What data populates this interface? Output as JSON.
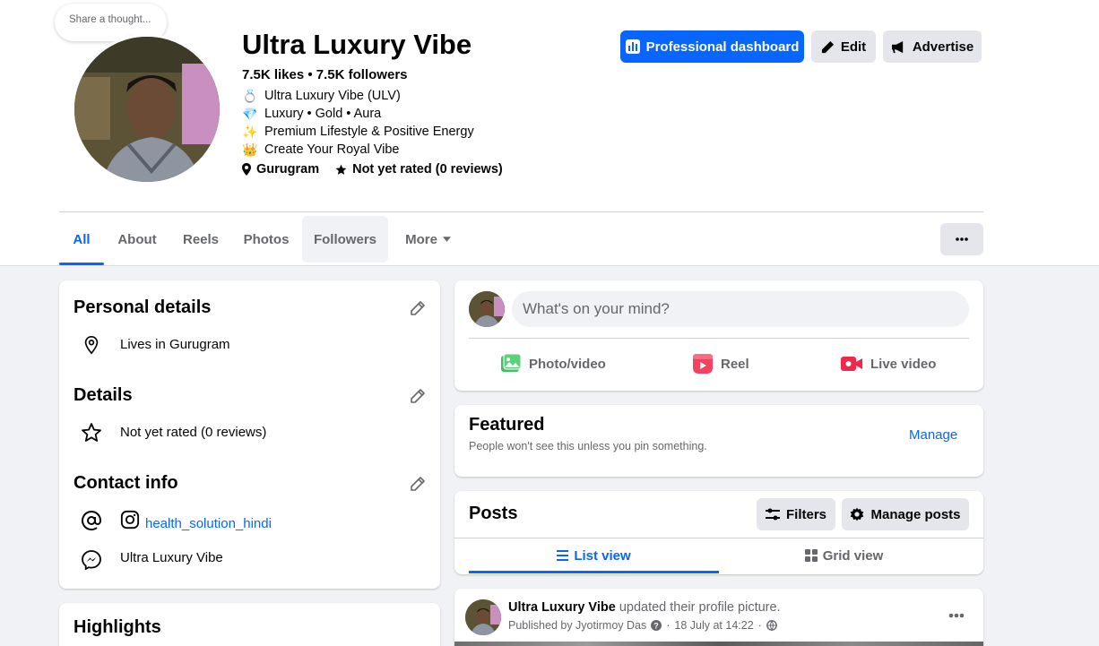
{
  "header": {
    "share_thought": "Share a thought...",
    "page_name": "Ultra Luxury Vibe",
    "likes_followers": "7.5K likes • 7.5K followers",
    "bio": [
      {
        "emoji": "💍",
        "text": "Ultra Luxury Vibe (ULV)"
      },
      {
        "emoji": "💎",
        "text": "Luxury • Gold • Aura"
      },
      {
        "emoji": "✨",
        "text": "Premium Lifestyle & Positive Energy"
      },
      {
        "emoji": "👑",
        "text": "Create Your Royal Vibe"
      }
    ],
    "location": "Gurugram",
    "rating": "Not yet rated (0 reviews)",
    "buttons": {
      "dashboard": "Professional dashboard",
      "edit": "Edit",
      "advertise": "Advertise"
    }
  },
  "tabs": [
    "All",
    "About",
    "Reels",
    "Photos",
    "Followers",
    "More"
  ],
  "left": {
    "personal_title": "Personal details",
    "lives_in": "Lives in Gurugram",
    "details_title": "Details",
    "rating": "Not yet rated (0 reviews)",
    "contact_title": "Contact info",
    "instagram": "health_solution_hindi",
    "messenger": "Ultra Luxury Vibe",
    "highlights_title": "Highlights"
  },
  "composer": {
    "placeholder": "What's on your mind?",
    "photo": "Photo/video",
    "reel": "Reel",
    "live": "Live video"
  },
  "featured": {
    "title": "Featured",
    "subtitle": "People won't see this unless you pin something.",
    "manage": "Manage"
  },
  "posts": {
    "title": "Posts",
    "filters": "Filters",
    "manage_posts": "Manage posts",
    "list_view": "List view",
    "grid_view": "Grid view"
  },
  "post": {
    "author": "Ultra Luxury Vibe",
    "action": "updated their profile picture.",
    "published_by": "Published by Jyotirmoy Das",
    "date": "18 July at 14:22"
  },
  "colors": {
    "accent": "#0866ff",
    "grey_button": "#e4e6eb",
    "background": "#f0f2f5"
  }
}
